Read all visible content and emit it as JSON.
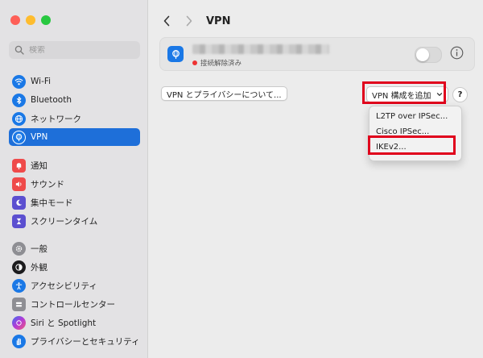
{
  "sidebar": {
    "search_placeholder": "検索",
    "groups": [
      [
        {
          "label": "Wi-Fi",
          "icon": "wifi-icon",
          "color": "#1a78e6"
        },
        {
          "label": "Bluetooth",
          "icon": "bluetooth-icon",
          "color": "#1a78e6"
        },
        {
          "label": "ネットワーク",
          "icon": "globe-icon",
          "color": "#1a78e6"
        },
        {
          "label": "VPN",
          "icon": "vpn-icon",
          "color": "#1a78e6",
          "active": true
        }
      ],
      [
        {
          "label": "通知",
          "icon": "bell-icon",
          "color": "#ef4a4a"
        },
        {
          "label": "サウンド",
          "icon": "speaker-icon",
          "color": "#ef4a4a"
        },
        {
          "label": "集中モード",
          "icon": "moon-icon",
          "color": "#5b4fd0"
        },
        {
          "label": "スクリーンタイム",
          "icon": "hourglass-icon",
          "color": "#5b4fd0"
        }
      ],
      [
        {
          "label": "一般",
          "icon": "gear-icon",
          "color": "#8e8e93"
        },
        {
          "label": "外観",
          "icon": "appearance-icon",
          "color": "#1c1c1e"
        },
        {
          "label": "アクセシビリティ",
          "icon": "accessibility-icon",
          "color": "#1a78e6"
        },
        {
          "label": "コントロールセンター",
          "icon": "control-center-icon",
          "color": "#8e8e93"
        },
        {
          "label": "Siri と Spotlight",
          "icon": "siri-icon",
          "color": "#7a3fd6"
        },
        {
          "label": "プライバシーとセキュリティ",
          "icon": "hand-icon",
          "color": "#1a78e6"
        }
      ]
    ]
  },
  "header": {
    "title": "VPN"
  },
  "vpn_card": {
    "status": "接続解除済み",
    "status_color": "#e33333"
  },
  "buttons": {
    "privacy": "VPN とプライバシーについて...",
    "add": "VPN 構成を追加",
    "help": "?"
  },
  "menu": {
    "items": [
      "L2TP over IPSec...",
      "Cisco IPSec...",
      "IKEv2..."
    ]
  },
  "colors": {
    "accent": "#1e6fd9",
    "highlight": "#e0001c"
  }
}
